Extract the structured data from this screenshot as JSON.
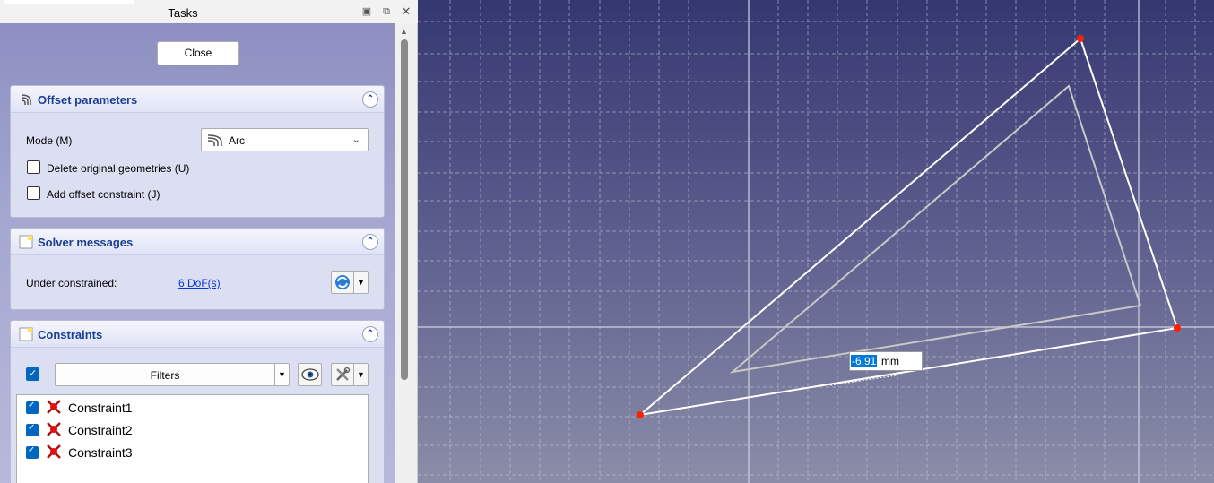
{
  "tasks_panel": {
    "title": "Tasks",
    "close_label": "Close",
    "offset_parameters": {
      "title": "Offset parameters",
      "mode_label": "Mode (M)",
      "mode_value": "Arc",
      "delete_original_label": "Delete original geometries (U)",
      "add_offset_constraint_label": "Add offset constraint (J)"
    },
    "solver_messages": {
      "title": "Solver messages",
      "status_label": "Under constrained:",
      "dof_link": "6 DoF(s)"
    },
    "constraints": {
      "title": "Constraints",
      "filter_label": "Filters",
      "items": [
        {
          "label": "Constraint1",
          "checked": true
        },
        {
          "label": "Constraint2",
          "checked": true
        },
        {
          "label": "Constraint3",
          "checked": true
        }
      ]
    }
  },
  "viewport": {
    "dimension_value": "-6,91",
    "dimension_unit": "mm",
    "colors": {
      "background_top": "#353771",
      "background_bottom": "#8b8da8",
      "sketch_line": "#ffffff",
      "offset_line": "#c8c8c8",
      "vertex": "#ff2000"
    }
  }
}
